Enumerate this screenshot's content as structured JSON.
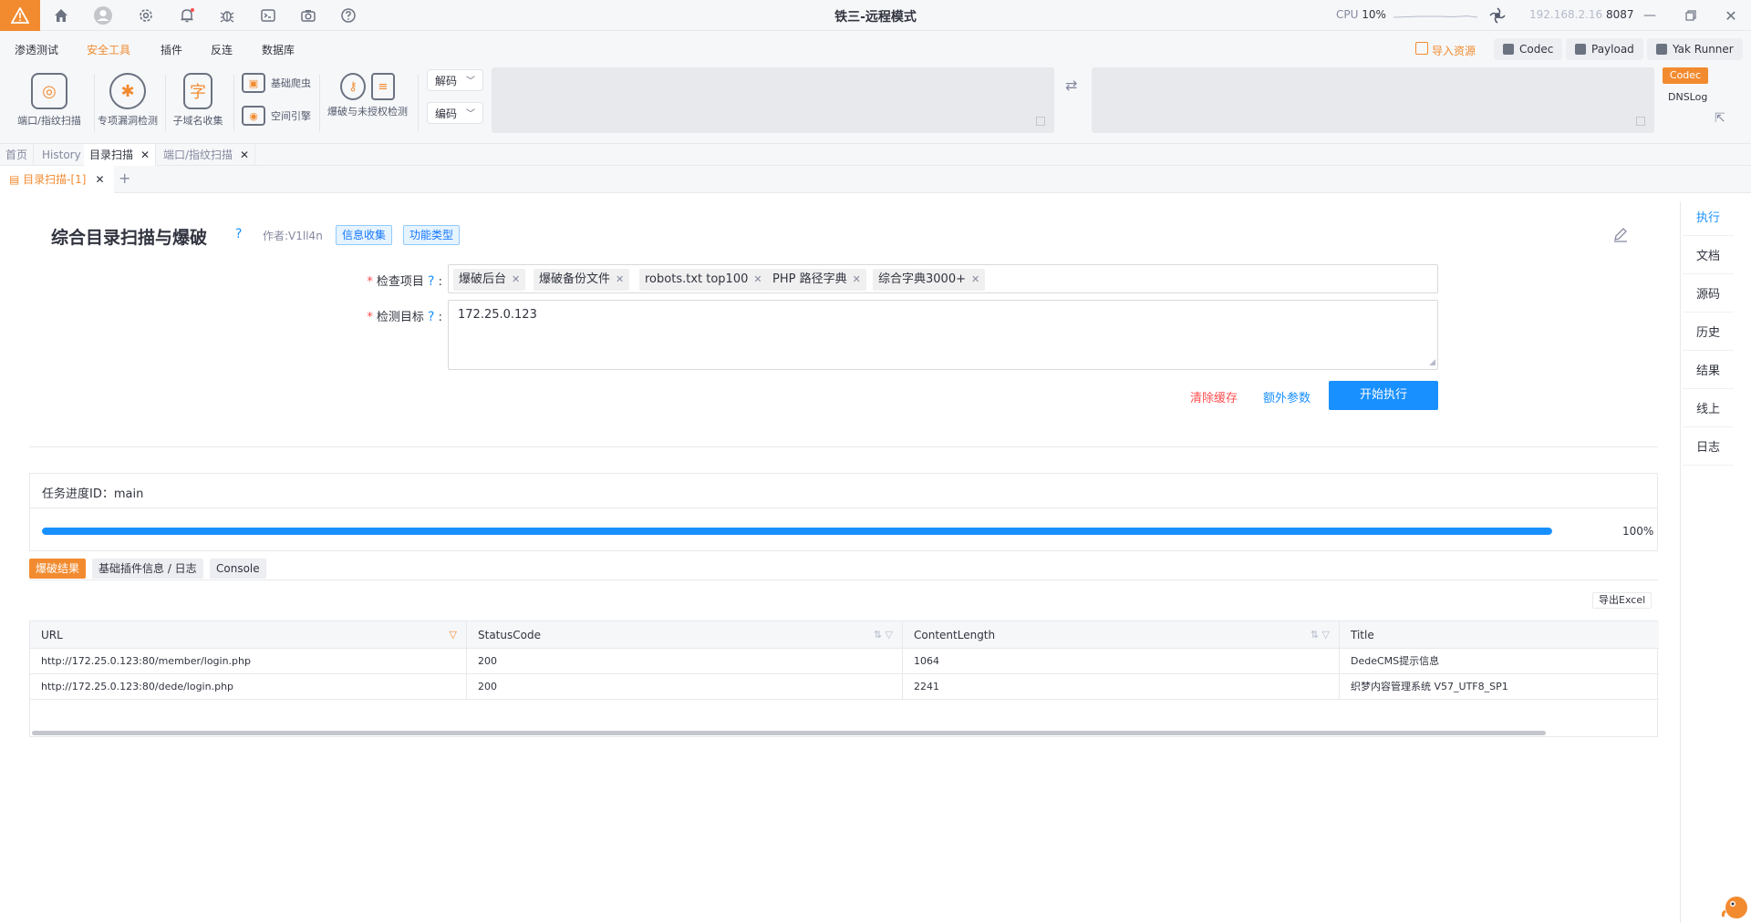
{
  "window": {
    "title": "铁三-远程模式",
    "cpu_label": "CPU",
    "cpu_value": "10%",
    "ip": "192.168.2.16",
    "port": "8087"
  },
  "menu": {
    "items": [
      "渗透测试",
      "安全工具",
      "插件",
      "反连",
      "数据库"
    ],
    "active_index": 1,
    "import_label": "导入资源",
    "codec_btn": "Codec",
    "payload_btn": "Payload",
    "yak_runner_btn": "Yak Runner"
  },
  "toolbar": {
    "port_scan": "端口/指纹扫描",
    "vuln_check": "专项漏洞检测",
    "subdomain": "子域名收集",
    "crawler": "基础爬虫",
    "space_engine": "空间引擎",
    "brute": "爆破与未授权检测",
    "decode_label": "解码",
    "encode_label": "编码",
    "codec_tag": "Codec",
    "dnslog": "DNSLog"
  },
  "tabs": {
    "top": [
      {
        "label": "首页",
        "closable": false
      },
      {
        "label": "History",
        "closable": false
      },
      {
        "label": "目录扫描",
        "closable": true,
        "active": true
      },
      {
        "label": "端口/指纹扫描",
        "closable": true
      }
    ],
    "sub": "目录扫描-[1]"
  },
  "plugin": {
    "title": "综合目录扫描与爆破",
    "author": "作者:V1ll4n",
    "tag_info": "信息收集",
    "tag_type": "功能类型",
    "check_items_label": "检查项目",
    "check_items": [
      "爆破后台",
      "爆破备份文件",
      "robots.txt top100",
      "PHP 路径字典",
      "综合字典3000+"
    ],
    "target_label": "检测目标",
    "target_value": "172.25.0.123",
    "clear_cache": "清除缓存",
    "extra_params": "额外参数",
    "start": "开始执行"
  },
  "progress": {
    "title": "任务进度ID：main",
    "value": 100,
    "text": "100%"
  },
  "result_tabs": [
    "爆破结果",
    "基础插件信息 / 日志",
    "Console"
  ],
  "export": "导出Excel",
  "table": {
    "columns": [
      "URL",
      "StatusCode",
      "ContentLength",
      "Title"
    ],
    "rows": [
      [
        "http://172.25.0.123:80/member/login.php",
        "200",
        "1064",
        "DedeCMS提示信息"
      ],
      [
        "http://172.25.0.123:80/dede/login.php",
        "200",
        "2241",
        "织梦内容管理系统 V57_UTF8_SP1"
      ]
    ]
  },
  "side": [
    "执行",
    "文档",
    "源码",
    "历史",
    "结果",
    "线上",
    "日志"
  ],
  "colors": {
    "accent": "#f28b30",
    "primary": "#1890ff",
    "danger": "#ff4d4f"
  }
}
